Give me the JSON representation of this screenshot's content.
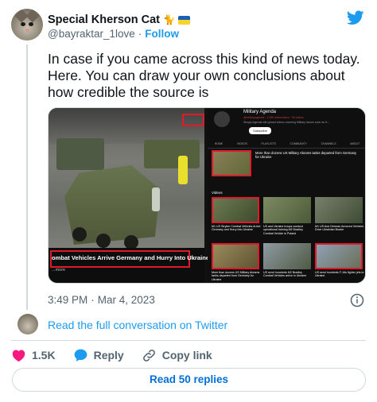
{
  "author": {
    "name": "Special Kherson Cat",
    "name_emoji": "🐈",
    "handle": "@bayraktar_1love",
    "follow_label": "Follow"
  },
  "tweet": {
    "text": "In case if you came across this kind of news today. Here.  You can draw your own conclusions about how credible the source is",
    "time": "3:49 PM",
    "separator": "·",
    "date": "Mar 4, 2023"
  },
  "media": {
    "video_caption": "ombat Vehicles Arrive Germany and Hurry Into Ukraine",
    "more_label": "...more",
    "channel_name": "Military Agenda",
    "channel_meta": "@militaryagenda · 1.28K subscribers · 26 videos",
    "channel_desc": "Simply Agenda will upload videos covering Military issues such as H...",
    "subscribe_label": "Subscribe",
    "tabs": [
      "HOME",
      "VIDEOS",
      "PLAYLISTS",
      "COMMUNITY",
      "CHANNELS",
      "ABOUT"
    ],
    "featured_title": "More than dozens US Military Abrams tanks departed from Germany for Ukraine",
    "videos_label": "Videos",
    "thumbs": [
      {
        "title": "M1 US Stryker Combat Vehicles Arrive Germany and Hurry Into Ukraine"
      },
      {
        "title": "US and Ukraine troops conduct operational training M2 Bradley Combat Vehicle in Poland"
      },
      {
        "title": "M1 US And German Armored Vehicles Drive Ukrainian Border"
      },
      {
        "title": "More than dozens US Military Abrams tanks departed from Germany for Ukraine"
      },
      {
        "title": "US send hundreds M2 Bradley Combat Vehicles arrive in Ukraine"
      },
      {
        "title": "US send hundreds F-16s fighter jets to Ukraine"
      }
    ]
  },
  "conversation": {
    "link_label": "Read the full conversation on Twitter"
  },
  "actions": {
    "like_count": "1.5K",
    "reply_label": "Reply",
    "copy_label": "Copy link"
  },
  "replies_button": "Read 50 replies",
  "colors": {
    "accent": "#1d9bf0",
    "like": "#f91880",
    "highlight_box": "#e0192b"
  }
}
